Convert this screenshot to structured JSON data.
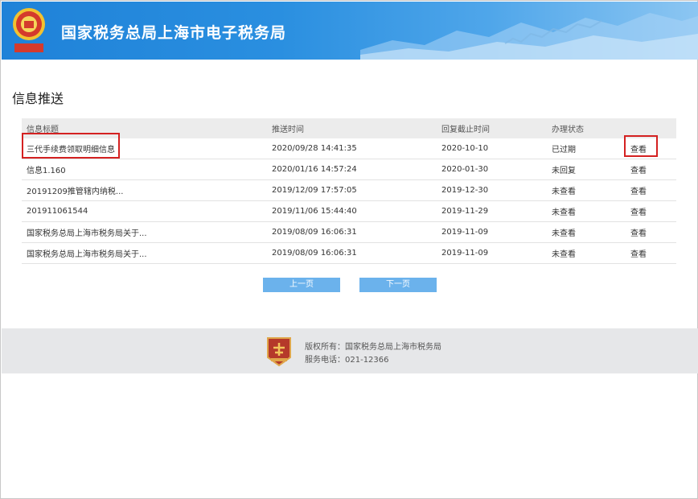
{
  "header": {
    "site_title": "国家税务总局上海市电子税务局",
    "emblem_icon": "tax-emblem-icon",
    "brand_color": "#2a8fe0"
  },
  "page": {
    "title": "信息推送"
  },
  "table": {
    "columns": [
      "信息标题",
      "推送时间",
      "回复截止时间",
      "办理状态",
      ""
    ],
    "rows": [
      {
        "title": "三代手续费领取明细信息",
        "push_time": "2020/09/28 14:41:35",
        "deadline": "2020-10-10",
        "status": "已过期",
        "action": "查看"
      },
      {
        "title": "信息1.160",
        "push_time": "2020/01/16 14:57:24",
        "deadline": "2020-01-30",
        "status": "未回复",
        "action": "查看"
      },
      {
        "title": "20191209推管辖内纳税...",
        "push_time": "2019/12/09 17:57:05",
        "deadline": "2019-12-30",
        "status": "未查看",
        "action": "查看"
      },
      {
        "title": "201911061544",
        "push_time": "2019/11/06 15:44:40",
        "deadline": "2019-11-29",
        "status": "未查看",
        "action": "查看"
      },
      {
        "title": "国家税务总局上海市税务局关于...",
        "push_time": "2019/08/09 16:06:31",
        "deadline": "2019-11-09",
        "status": "未查看",
        "action": "查看"
      },
      {
        "title": "国家税务总局上海市税务局关于...",
        "push_time": "2019/08/09 16:06:31",
        "deadline": "2019-11-09",
        "status": "未查看",
        "action": "查看"
      }
    ],
    "highlight_color": "#d42121"
  },
  "pager": {
    "prev_label": "上一页",
    "next_label": "下一页",
    "button_color": "#6bb2ec"
  },
  "footer": {
    "copyright": "版权所有：国家税务总局上海市税务局",
    "phone": "服务电话：021-12366",
    "badge_icon": "tax-badge-icon"
  }
}
